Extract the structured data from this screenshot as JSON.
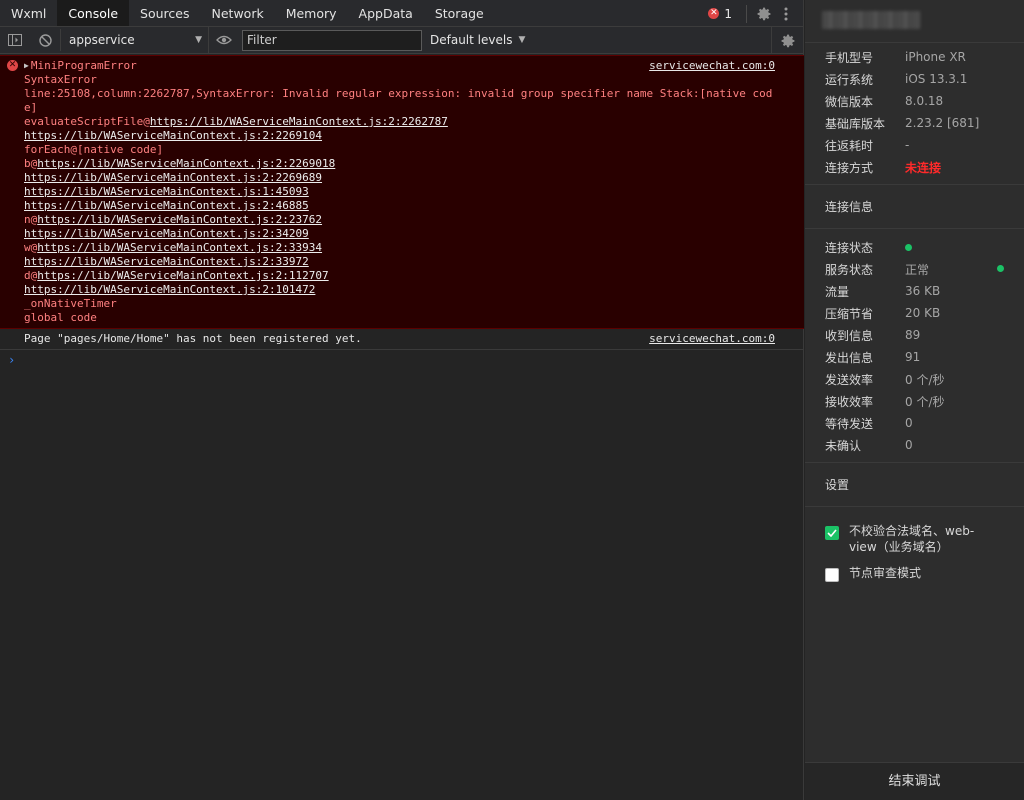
{
  "tabs": [
    {
      "label": "Wxml"
    },
    {
      "label": "Console"
    },
    {
      "label": "Sources"
    },
    {
      "label": "Network"
    },
    {
      "label": "Memory"
    },
    {
      "label": "AppData"
    },
    {
      "label": "Storage"
    }
  ],
  "active_tab": "Console",
  "error_count": "1",
  "toolbar": {
    "context": "appservice",
    "filter_placeholder": "Filter",
    "levels": "Default levels"
  },
  "console": {
    "error": {
      "title": "MiniProgramError",
      "source": "servicewechat.com:0",
      "lines": {
        "l1": "SyntaxError",
        "l2": "line:25108,column:2262787,SyntaxError: Invalid regular expression: invalid group specifier name Stack:[native code]",
        "l3_prefix": "evaluateScriptFile@",
        "l3_link": "https://lib/WAServiceMainContext.js:2:2262787",
        "l4": "https://lib/WAServiceMainContext.js:2:2269104",
        "l5": "forEach@[native code]",
        "l6_prefix": "b@",
        "l6_link": "https://lib/WAServiceMainContext.js:2:2269018",
        "l7": "https://lib/WAServiceMainContext.js:2:2269689",
        "l8": "https://lib/WAServiceMainContext.js:1:45093",
        "l9": "https://lib/WAServiceMainContext.js:2:46885",
        "l10_prefix": "n@",
        "l10_link": "https://lib/WAServiceMainContext.js:2:23762",
        "l11": "https://lib/WAServiceMainContext.js:2:34209",
        "l12_prefix": "w@",
        "l12_link": "https://lib/WAServiceMainContext.js:2:33934",
        "l13": "https://lib/WAServiceMainContext.js:2:33972",
        "l14_prefix": "d@",
        "l14_link": "https://lib/WAServiceMainContext.js:2:112707",
        "l15": "https://lib/WAServiceMainContext.js:2:101472",
        "l16": "_onNativeTimer",
        "l17": "global code"
      }
    },
    "message": {
      "text": "Page \"pages/Home/Home\" has not been registered yet.",
      "source": "servicewechat.com:0"
    },
    "prompt": "›"
  },
  "panel": {
    "device": [
      {
        "key": "手机型号",
        "value": "iPhone XR"
      },
      {
        "key": "运行系统",
        "value": "iOS 13.3.1"
      },
      {
        "key": "微信版本",
        "value": "8.0.18"
      },
      {
        "key": "基础库版本",
        "value": "2.23.2 [681]"
      },
      {
        "key": "往返耗时",
        "value": "-"
      },
      {
        "key": "连接方式",
        "value": "未连接"
      }
    ],
    "connection_title": "连接信息",
    "stats": {
      "status": "连接状态",
      "service": {
        "key": "服务状态",
        "value": "正常"
      },
      "rows": [
        {
          "key": "流量",
          "value": "36 KB"
        },
        {
          "key": "压缩节省",
          "value": "20 KB"
        },
        {
          "key": "收到信息",
          "value": "89"
        },
        {
          "key": "发出信息",
          "value": "91"
        },
        {
          "key": "发送效率",
          "value": "0 个/秒"
        },
        {
          "key": "接收效率",
          "value": "0 个/秒"
        },
        {
          "key": "等待发送",
          "value": "0"
        },
        {
          "key": "未确认",
          "value": "0"
        }
      ]
    },
    "settings_title": "设置",
    "settings": [
      {
        "label": "不校验合法域名、web-view（业务域名）",
        "checked": true
      },
      {
        "label": "节点审查模式",
        "checked": false
      }
    ],
    "end_button": "结束调试"
  },
  "colors": {
    "accent_green": "#1bc266",
    "error_red": "#e04646",
    "disconnected_red": "#ff2a2a"
  }
}
